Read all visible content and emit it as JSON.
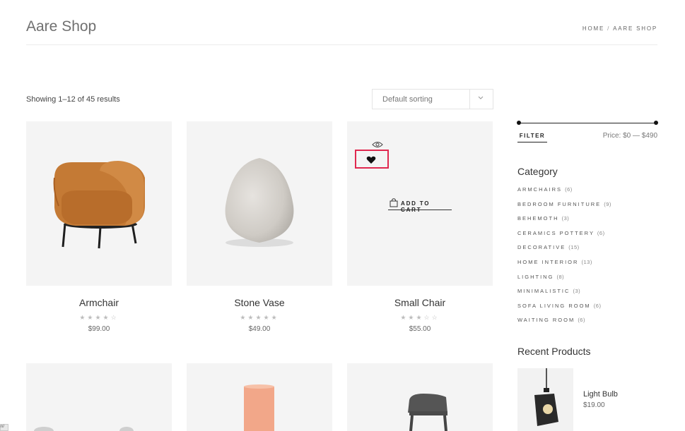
{
  "header": {
    "title": "Aare Shop",
    "breadcrumb": {
      "home": "HOME",
      "separator": "/",
      "current": "AARE SHOP"
    }
  },
  "toolbar": {
    "result_count": "Showing 1–12 of 45 results",
    "sorting": {
      "selected": "Default sorting"
    }
  },
  "products": [
    {
      "name": "Armchair",
      "rating": 4,
      "stars": "★★★★☆",
      "price": "$99.00"
    },
    {
      "name": "Stone Vase",
      "rating": 5,
      "stars": "★★★★★",
      "price": "$49.00"
    },
    {
      "name": "Small Chair",
      "rating": 3,
      "stars": "★★★☆☆",
      "price": "$55.00",
      "hover_actions": {
        "add_to_cart": "ADD TO CART"
      }
    },
    {
      "name": "",
      "price": ""
    },
    {
      "name": "",
      "price": ""
    },
    {
      "name": "",
      "price": ""
    }
  ],
  "sidebar": {
    "price_filter": {
      "button": "FILTER",
      "label": "Price: $0 — $490",
      "min_fraction": 0,
      "max_fraction": 1
    },
    "category": {
      "title": "Category",
      "items": [
        {
          "label": "ARMCHAIRS",
          "count": "(6)"
        },
        {
          "label": "BEDROOM FURNITURE",
          "count": "(9)"
        },
        {
          "label": "BEHEMOTH",
          "count": "(3)"
        },
        {
          "label": "CERAMICS POTTERY",
          "count": "(6)"
        },
        {
          "label": "DECORATIVE",
          "count": "(15)"
        },
        {
          "label": "HOME INTERIOR",
          "count": "(13)"
        },
        {
          "label": "LIGHTING",
          "count": "(8)"
        },
        {
          "label": "MINIMALISTIC",
          "count": "(3)"
        },
        {
          "label": "SOFA LIVING ROOM",
          "count": "(6)"
        },
        {
          "label": "WAITING ROOM",
          "count": "(6)"
        }
      ]
    },
    "recent": {
      "title": "Recent Products",
      "items": [
        {
          "name": "Light Bulb",
          "price": "$19.00"
        }
      ]
    }
  },
  "icons": {
    "quick_view": "eye-icon",
    "wishlist": "heart-icon",
    "cart": "shopping-bag-icon",
    "sort": "chevron-down-icon"
  },
  "colors": {
    "highlight": "#e0284f",
    "card_background": "#f4f4f4",
    "armchair": "#c47a35",
    "stone": "#d9d6d1",
    "vase_pink": "#f2a789"
  },
  "corner_tag": "n/"
}
